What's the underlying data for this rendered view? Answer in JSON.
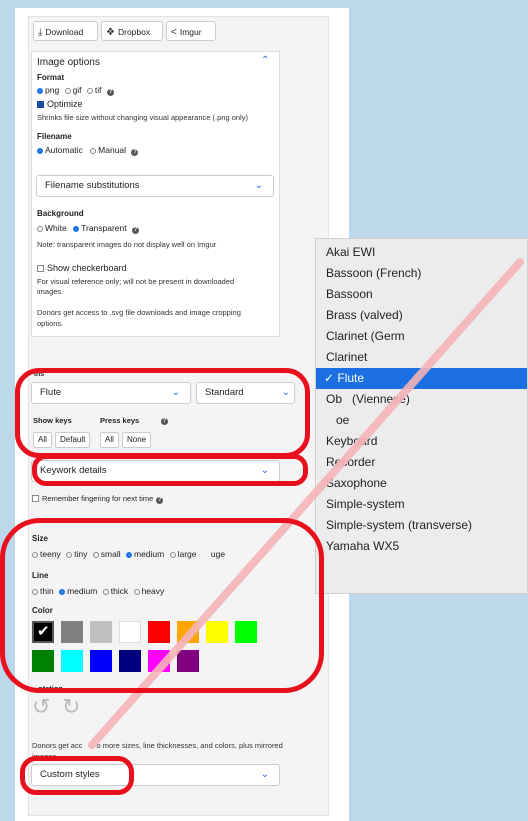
{
  "toolbar": {
    "download": "Download",
    "dropbox": "Dropbox",
    "imgur": "Imgur"
  },
  "image_options": {
    "title": "Image options",
    "format_label": "Format",
    "formats": [
      "png",
      "gif",
      "tif"
    ],
    "selected_format": "png",
    "optimize_label": "Optimize",
    "optimize_checked": true,
    "optimize_note": "Shrinks file size without changing visual appearance (.png only)",
    "filename_label": "Filename",
    "filename_automatic": "Automatic",
    "filename_manual": "Manual",
    "filename_substitutions": "Filename substitutions",
    "background_label": "Background",
    "background_white": "White",
    "background_transparent": "Transparent",
    "transparent_note": "Note: transparent images do not display well on Imgur",
    "checkerboard_label": "Show checkerboard",
    "checkerboard_note_1": "For visual reference only; will not be present in downloaded",
    "checkerboard_note_2": "images.",
    "donors_note_1": "Donors get access to .svg file downloads and image cropping",
    "donors_note_2": "options."
  },
  "instrument": {
    "partial_label": "Ins",
    "selected": "Flute",
    "variant": "Standard",
    "show_keys_label": "Show keys",
    "press_keys_label": "Press keys",
    "show_all": "All",
    "show_default": "Default",
    "press_all": "All",
    "press_none": "None"
  },
  "keywork": {
    "label": "Keywork details"
  },
  "remember": {
    "label": "Remember fingering for next time"
  },
  "size": {
    "label": "Size",
    "options": [
      "teeny",
      "tiny",
      "small",
      "medium",
      "large",
      "huge"
    ],
    "selected": "medium",
    "visible_text": [
      "teeny",
      "tiny",
      "small",
      "medium",
      "large",
      "uge"
    ]
  },
  "line": {
    "label": "Line",
    "options": [
      "thin",
      "medium",
      "thick",
      "heavy"
    ],
    "selected": "medium"
  },
  "color": {
    "label": "Color",
    "swatches": [
      "#000000",
      "#808080",
      "#c0c0c0",
      "#ffffff",
      "#ff0000",
      "#ffa500",
      "#ffff00",
      "#00ff00",
      "#008000",
      "#00ffff",
      "#0000ff",
      "#000080",
      "#ff00ff",
      "#800080"
    ],
    "selected": "#000000"
  },
  "rotation": {
    "label": "otation"
  },
  "donors_styles": {
    "line1_a": "Donors get acc",
    "line1_b": "o more sizes, line thicknesses, and colors, plus mirrored",
    "line2": "images."
  },
  "custom_styles": {
    "label": "Custom styles"
  },
  "dropdown": {
    "items": [
      "Akai EWI",
      "Bassoon (French)",
      "Bassoon",
      "Brass (valved)",
      "Clarinet (Germ",
      "Clarinet",
      "Flute",
      "Ob",
      "(Viennese)",
      "oe",
      "Keyboard",
      "Recorder",
      "Saxophone",
      "Simple-system",
      "Simple-system (transverse)",
      "Yamaha WX5"
    ],
    "selected": "Flute"
  }
}
